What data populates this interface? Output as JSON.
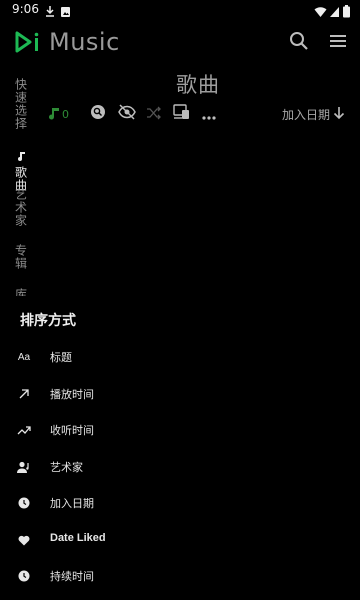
{
  "status_bar": {
    "time": "9:06",
    "icons": [
      "download-icon",
      "photo-icon",
      "wifi-icon",
      "signal-icon",
      "battery-icon"
    ]
  },
  "app_bar": {
    "title": "Music",
    "logo_color": "#1db954",
    "actions": [
      "search-icon",
      "menu-icon"
    ]
  },
  "side_tabs": [
    {
      "label": "快速选择",
      "active": false
    },
    {
      "label": "歌曲",
      "active": true,
      "icon": "music-note-icon"
    },
    {
      "label": "艺术家",
      "active": false
    },
    {
      "label": "专辑",
      "active": false
    },
    {
      "label": "库",
      "active": false
    }
  ],
  "main": {
    "title": "歌曲",
    "toolbar": {
      "song_count": "0",
      "sort_label": "加入日期",
      "accent_color": "#2e8b36",
      "icons": [
        "music-note-icon",
        "search-icon",
        "hidden-eye-icon",
        "shuffle-icon",
        "devices-icon",
        "more-icon",
        "arrow-down-icon"
      ]
    }
  },
  "sort_sheet": {
    "title": "排序方式",
    "options": [
      {
        "label": "标题",
        "icon": "text-aa-icon"
      },
      {
        "label": "播放时间",
        "icon": "arrow-up-right-icon"
      },
      {
        "label": "收听时间",
        "icon": "trending-up-icon"
      },
      {
        "label": "艺术家",
        "icon": "person-icon"
      },
      {
        "label": "加入日期",
        "icon": "clock-icon"
      },
      {
        "label": "Date Liked",
        "icon": "heart-icon"
      },
      {
        "label": "持续时间",
        "icon": "clock-icon"
      }
    ]
  }
}
